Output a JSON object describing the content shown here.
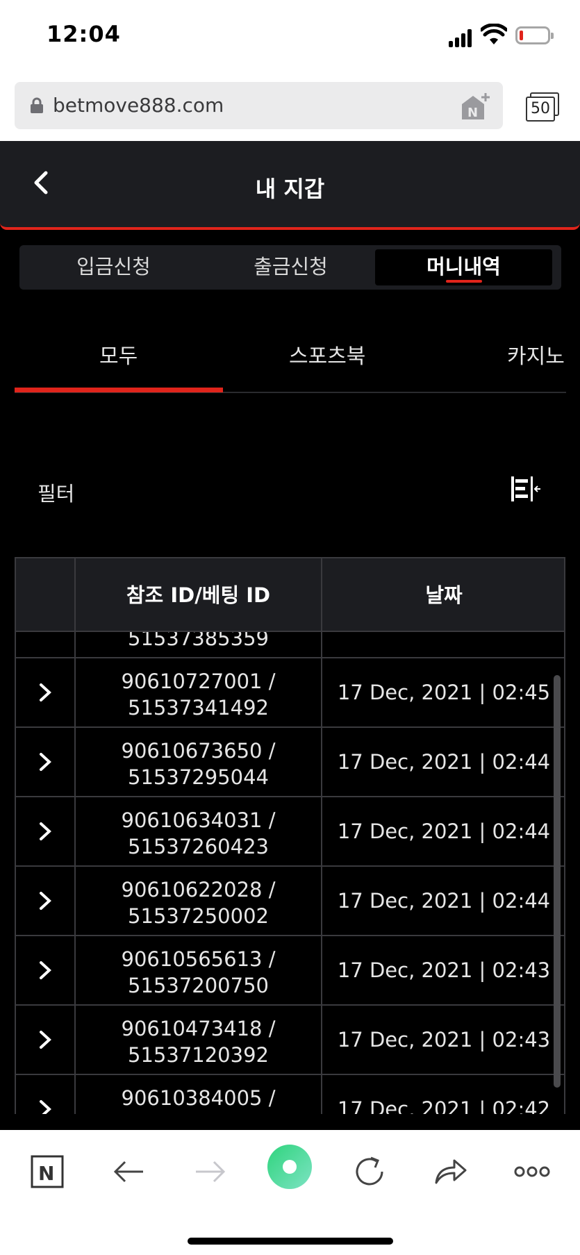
{
  "status": {
    "time": "12:04"
  },
  "browser": {
    "url": "betmove888.com",
    "tab_count": "50"
  },
  "header": {
    "title": "내 지갑"
  },
  "segments": [
    {
      "label": "입금신청",
      "active": false
    },
    {
      "label": "출금신청",
      "active": false
    },
    {
      "label": "머니내역",
      "active": true
    }
  ],
  "categories": [
    {
      "label": "모두",
      "active": true
    },
    {
      "label": "스포츠북",
      "active": false
    },
    {
      "label": "카지노",
      "active": false
    }
  ],
  "filter": {
    "label": "필터"
  },
  "table": {
    "headers": {
      "ref": "참조 ID/베팅 ID",
      "date": "날짜"
    },
    "partial_top": {
      "bet_id": "51537385359"
    },
    "rows": [
      {
        "ref_id": "90610727001 /",
        "bet_id": "51537341492",
        "date": "17 Dec, 2021 | 02:45"
      },
      {
        "ref_id": "90610673650 /",
        "bet_id": "51537295044",
        "date": "17 Dec, 2021 | 02:44"
      },
      {
        "ref_id": "90610634031 /",
        "bet_id": "51537260423",
        "date": "17 Dec, 2021 | 02:44"
      },
      {
        "ref_id": "90610622028 /",
        "bet_id": "51537250002",
        "date": "17 Dec, 2021 | 02:44"
      },
      {
        "ref_id": "90610565613 /",
        "bet_id": "51537200750",
        "date": "17 Dec, 2021 | 02:43"
      },
      {
        "ref_id": "90610473418 /",
        "bet_id": "51537120392",
        "date": "17 Dec, 2021 | 02:43"
      },
      {
        "ref_id": "90610384005 /",
        "bet_id": "",
        "date": "17 Dec, 2021 | 02:42"
      }
    ]
  },
  "colors": {
    "accent": "#e0241b",
    "header_bg": "#1c1d21",
    "page_bg": "#000000"
  }
}
